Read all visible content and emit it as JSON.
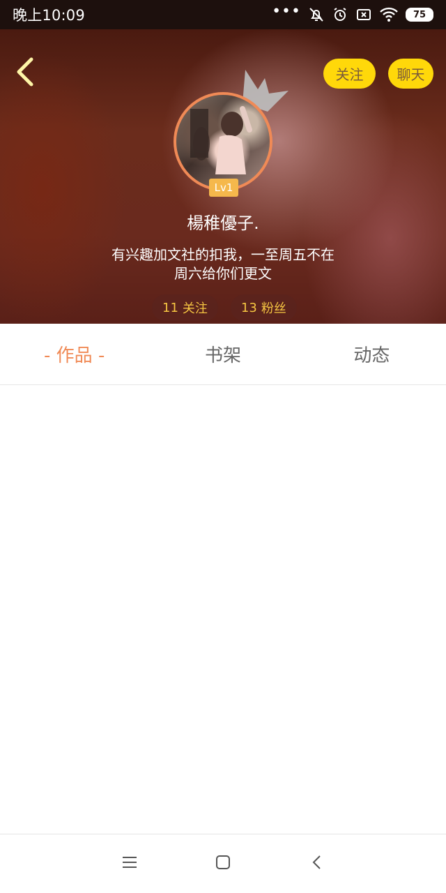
{
  "status_bar": {
    "time": "晚上10:09",
    "dots": "•••",
    "battery": "75"
  },
  "header": {
    "follow_button": "关注",
    "chat_button": "聊天",
    "level_badge": "Lv1",
    "username": "楊稚優子.",
    "bio_line1": "有兴趣加文社的扣我，一至周五不在",
    "bio_line2": "周六给你们更文",
    "following_count": "11",
    "following_label": "关注",
    "fans_count": "13",
    "fans_label": "粉丝"
  },
  "tabs": {
    "works_dash_left": "-",
    "works_label": "作品",
    "works_dash_right": "-",
    "bookshelf_label": "书架",
    "activity_label": "动态"
  },
  "colors": {
    "accent": "#f08a56",
    "button_yellow": "#ffd80a",
    "stat_text": "#f5c542"
  },
  "icons": {
    "back": "chevron-left-icon",
    "crown": "crown-icon",
    "menu": "menu-icon",
    "home": "home-square-icon",
    "nav_back": "nav-back-icon"
  }
}
